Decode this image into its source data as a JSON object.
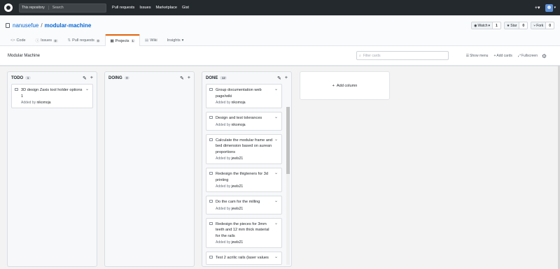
{
  "header": {
    "search_scope": "This repository",
    "search_placeholder": "Search",
    "nav": [
      "Pull requests",
      "Issues",
      "Marketplace",
      "Gist"
    ],
    "plus_icon": "plus-icon",
    "avatar_icon": "avatar"
  },
  "repo": {
    "owner": "nanusefue",
    "separator": "/",
    "name": "modular-machine",
    "watch_label": "Watch",
    "watch_count": "1",
    "star_label": "Star",
    "star_count": "0",
    "fork_label": "Fork",
    "fork_count": "0",
    "tabs": [
      {
        "label": "Code",
        "icon": "code-icon",
        "count": ""
      },
      {
        "label": "Issues",
        "icon": "issue-icon",
        "count": "0"
      },
      {
        "label": "Pull requests",
        "icon": "pull-request-icon",
        "count": "0"
      },
      {
        "label": "Projects",
        "icon": "project-icon",
        "count": "1"
      },
      {
        "label": "Wiki",
        "icon": "wiki-icon",
        "count": ""
      },
      {
        "label": "Insights",
        "icon": "graph-icon",
        "count": ""
      }
    ]
  },
  "project": {
    "name": "Modular Machine",
    "filter_placeholder": "Filter cards",
    "show_menu": "Show menu",
    "add_cards": "Add cards",
    "fullscreen": "Fullscreen"
  },
  "columns": [
    {
      "title": "TODO",
      "count": "1",
      "cards": [
        {
          "title": "3D design Zaxis tool holder options 1",
          "added_by_prefix": "Added by",
          "user": "nikomoja"
        }
      ]
    },
    {
      "title": "DOING",
      "count": "0",
      "cards": []
    },
    {
      "title": "DONE",
      "count": "12",
      "cards": [
        {
          "title": "Group documentation web page/wiki",
          "added_by_prefix": "Added by",
          "user": "nikomoja"
        },
        {
          "title": "Design and test tolerances",
          "added_by_prefix": "Added by",
          "user": "nikomoja"
        },
        {
          "title": "Calculate the modular frame and bed dimension based on aurean proportions",
          "added_by_prefix": "Added by",
          "user": "jewls21"
        },
        {
          "title": "Redesign the thigteners for 3d printing",
          "added_by_prefix": "Added by",
          "user": "jewls21"
        },
        {
          "title": "Do the cam for the milling",
          "added_by_prefix": "Added by",
          "user": "jewls21"
        },
        {
          "title": "Redesign the pieces for 3mm teeth and 12 mm thick material for the rails",
          "added_by_prefix": "Added by",
          "user": "jewls21"
        },
        {
          "title": "Test 2 acrilic rails (laser values",
          "added_by_prefix": "",
          "user": ""
        }
      ]
    }
  ],
  "add_column_label": "Add column"
}
